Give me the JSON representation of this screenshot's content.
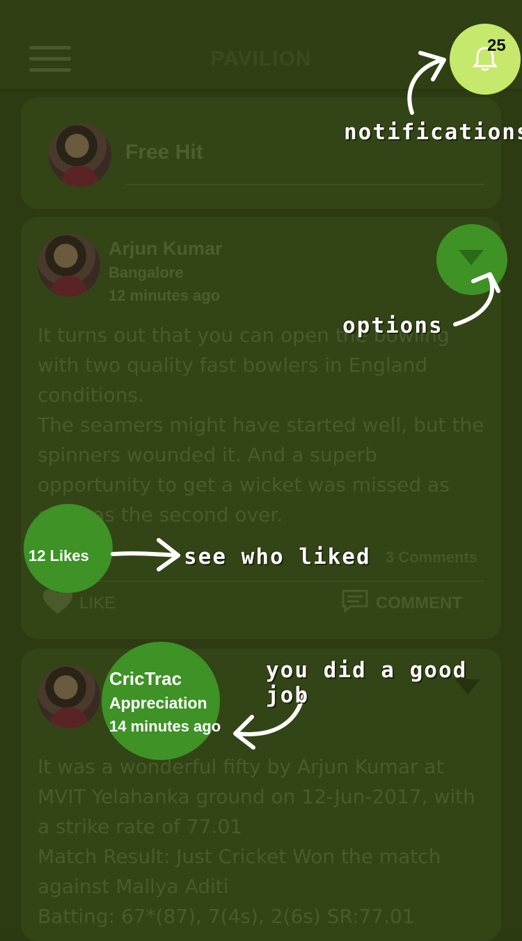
{
  "header": {
    "title": "PAVILION",
    "notification_count": "25"
  },
  "compose": {
    "placeholder": "Free Hit"
  },
  "posts": [
    {
      "author": "Arjun Kumar",
      "location": "Bangalore",
      "time": "12 minutes ago",
      "body": "It turns out that you can open the bowling with two quality fast bowlers in England conditions.\nThe seamers might have started well, but the spinners wounded it. And a superb opportunity to get a wicket was missed as early as the second over.",
      "likes": "12 Likes",
      "comments": "3 Comments",
      "like_label": "LIKE",
      "comment_label": "COMMENT"
    },
    {
      "author": "CricTrac",
      "location": "Appreciation",
      "time": "14 minutes ago",
      "body": "It was a wonderful fifty by Arjun Kumar at MVIT Yelahanka ground on 12-Jun-2017, with a strike rate of 77.01\nMatch Result: Just Cricket Won the match against Mallya Aditi\nBatting: 67*(87), 7(4s), 2(6s)  SR:77.01"
    }
  ],
  "callouts": {
    "notifications": "notifications",
    "options": "options",
    "see_who_liked": "see who liked",
    "good_job": "you did a good job"
  },
  "colors": {
    "accent_green": "#3e9226",
    "bell_circle": "#c6e86c",
    "overlay": "#2d3b13"
  }
}
